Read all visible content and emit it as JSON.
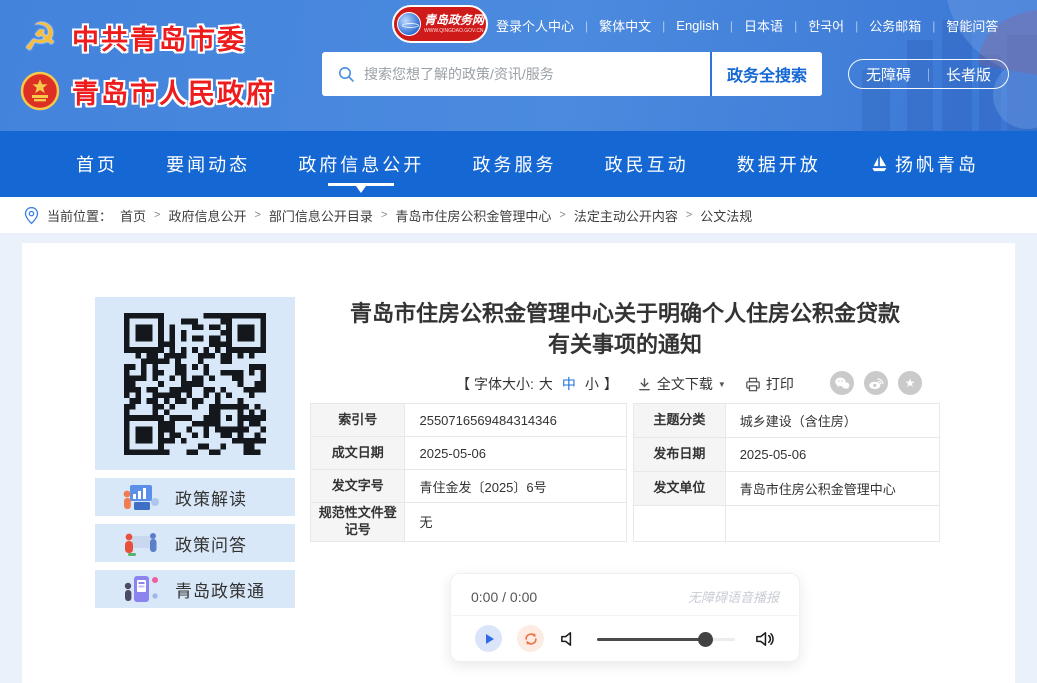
{
  "header": {
    "org_logos": [
      {
        "title": "中共青岛市委"
      },
      {
        "title": "青岛市人民政府"
      }
    ],
    "portal_logo": {
      "title": "青岛政务网",
      "subtitle": "WWW.QINGDAO.GOV.CN"
    },
    "top_links": [
      "登录个人中心",
      "繁体中文",
      "English",
      "日本语",
      "한국어",
      "公务邮箱",
      "智能问答"
    ],
    "link_separator": "|",
    "search": {
      "placeholder": "搜索您想了解的政策/资讯/服务",
      "button_label": "政务全搜索"
    },
    "accessibility_label": "无障碍",
    "elder_label": "长者版",
    "pill_separator": "｜"
  },
  "nav": {
    "items": [
      {
        "label": "首页",
        "active": false
      },
      {
        "label": "要闻动态",
        "active": false
      },
      {
        "label": "政府信息公开",
        "active": true
      },
      {
        "label": "政务服务",
        "active": false
      },
      {
        "label": "政民互动",
        "active": false
      },
      {
        "label": "数据开放",
        "active": false
      },
      {
        "label": "扬帆青岛",
        "active": false,
        "icon": "sailboat"
      }
    ]
  },
  "breadcrumb": {
    "prefix": "当前位置：",
    "separator": ">",
    "items": [
      "首页",
      "政府信息公开",
      "部门信息公开目录",
      "青岛市住房公积金管理中心",
      "法定主动公开内容",
      "公文法规"
    ]
  },
  "sidebar": {
    "items": [
      {
        "label": "政策解读"
      },
      {
        "label": "政策问答"
      },
      {
        "label": "青岛政策通"
      }
    ]
  },
  "article": {
    "title_lines": [
      "青岛市住房公积金管理中心关于明确个人住房公积金贷款",
      "有关事项的通知"
    ],
    "toolbar": {
      "fontsize_prefix": "【 字体大小:",
      "size_large": "大",
      "size_medium": "中",
      "size_small": "小",
      "active_size": "中",
      "fontsize_suffix": "】",
      "download_label": "全文下载",
      "download_caret": "▼",
      "print_label": "打印",
      "share_icons": [
        "wechat",
        "weibo",
        "favorite"
      ]
    },
    "meta_rows": [
      {
        "label1": "索引号",
        "value1": "2550716569484314346",
        "label2": "主题分类",
        "value2": "城乡建设（含住房）"
      },
      {
        "label1": "成文日期",
        "value1": "2025-05-06",
        "label2": "发布日期",
        "value2": "2025-05-06"
      },
      {
        "label1": "发文字号",
        "value1": "青住金发〔2025〕6号",
        "label2": "发文单位",
        "value2": "青岛市住房公积金管理中心"
      },
      {
        "label1": "规范性文件登记号",
        "value1": "无",
        "label2": "",
        "value2": ""
      }
    ]
  },
  "audio_player": {
    "time": "0:00 / 0:00",
    "caption": "无障碍语音播报",
    "volume_percent": 78
  },
  "colors": {
    "header_blue": "#4383dc",
    "nav_blue": "#1568d3",
    "accent_blue": "#1b6fdc",
    "light_blue_bg": "#d9e8f8",
    "page_bg": "#eaf1fa",
    "logo_red": "#ee1c1c"
  }
}
